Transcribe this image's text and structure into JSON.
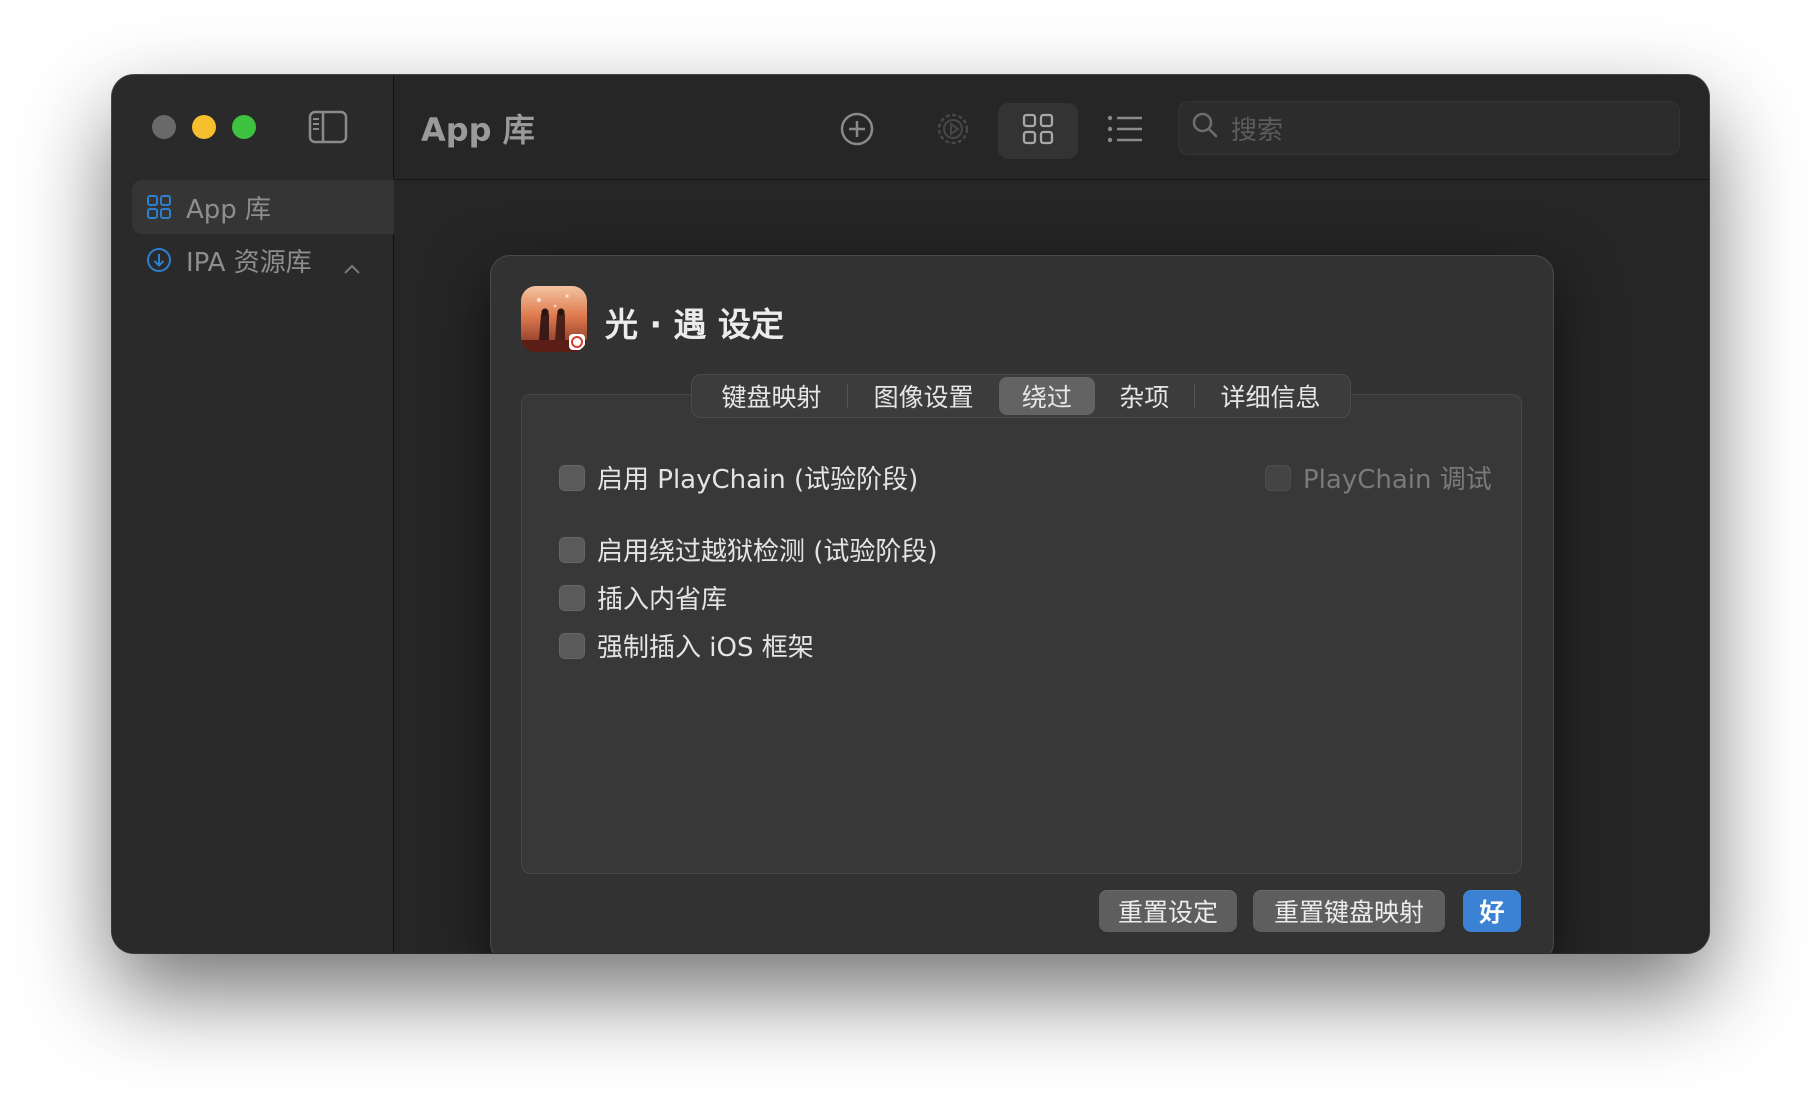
{
  "window": {
    "sidebar": {
      "items": [
        {
          "label": "App 库",
          "icon": "grid-icon"
        },
        {
          "label": "IPA 资源库",
          "icon": "download-circle-icon"
        }
      ]
    },
    "toolbar": {
      "title": "App 库",
      "search_placeholder": "搜索"
    }
  },
  "sheet": {
    "title": "光 · 遇 设定",
    "tabs": [
      "键盘映射",
      "图像设置",
      "绕过",
      "杂项",
      "详细信息"
    ],
    "active_tab": "绕过",
    "options": {
      "playchain": {
        "label": "启用 PlayChain (试验阶段)",
        "checked": false
      },
      "playchain_debug": {
        "label": "PlayChain 调试",
        "checked": false,
        "enabled": false
      },
      "jailbreak_bypass": {
        "label": "启用绕过越狱检测 (试验阶段)",
        "checked": false
      },
      "introspection": {
        "label": "插入内省库",
        "checked": false
      },
      "ios_frameworks": {
        "label": "强制插入 iOS 框架",
        "checked": false
      }
    },
    "buttons": {
      "reset_settings": "重置设定",
      "reset_keymap": "重置键盘映射",
      "ok": "好"
    }
  },
  "colors": {
    "accent": "#3b82d4",
    "close": "#6a6a6a",
    "minimize": "#f5bf2e",
    "maximize": "#3fc240"
  }
}
